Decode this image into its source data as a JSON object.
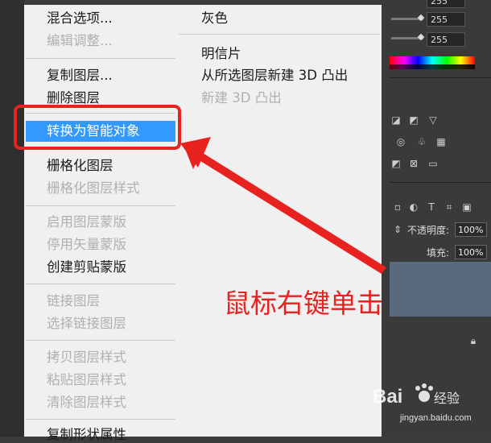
{
  "right_panel": {
    "channel_values": [
      "255",
      "255",
      "255"
    ],
    "opacity_label": "不透明度:",
    "opacity_value": "100%",
    "fill_label": "填充:",
    "fill_value": "100%"
  },
  "context_menu": {
    "left_items": [
      {
        "label": "混合选项...",
        "enabled": true
      },
      {
        "label": "编辑调整...",
        "enabled": false
      },
      {
        "label": "复制图层...",
        "enabled": true
      },
      {
        "label": "删除图层",
        "enabled": true
      },
      {
        "label": "转换为智能对象",
        "enabled": true,
        "highlighted": true
      },
      {
        "label": "栅格化图层",
        "enabled": true
      },
      {
        "label": "栅格化图层样式",
        "enabled": false
      },
      {
        "label": "启用图层蒙版",
        "enabled": false
      },
      {
        "label": "停用矢量蒙版",
        "enabled": false
      },
      {
        "label": "创建剪贴蒙版",
        "enabled": true
      },
      {
        "label": "链接图层",
        "enabled": false
      },
      {
        "label": "选择链接图层",
        "enabled": false
      },
      {
        "label": "拷贝图层样式",
        "enabled": false
      },
      {
        "label": "粘贴图层样式",
        "enabled": false
      },
      {
        "label": "清除图层样式",
        "enabled": false
      },
      {
        "label": "复制形状属性",
        "enabled": true
      }
    ],
    "right_items": [
      {
        "label": "灰色",
        "enabled": true
      },
      {
        "label": "明信片",
        "enabled": true
      },
      {
        "label": "从所选图层新建 3D 凸出",
        "enabled": true
      },
      {
        "label": "新建 3D 凸出",
        "enabled": false
      }
    ]
  },
  "annotation": {
    "text": "鼠标右键单击",
    "color": "#e8221f"
  },
  "watermark": {
    "brand": "Bai",
    "brand2": "du",
    "product": "经验",
    "url": "jingyan.baidu.com"
  },
  "colors": {
    "highlight": "#3399ff",
    "menu_bg": "#f0f0f0",
    "disabled_text": "#b0b0b0",
    "annotation_red": "#e8221f"
  }
}
